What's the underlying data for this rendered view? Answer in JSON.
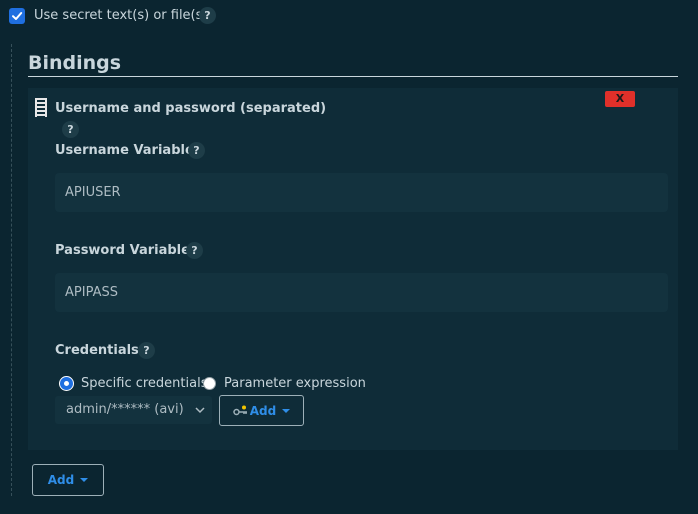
{
  "use_secret": {
    "checked": true,
    "label": "Use secret text(s) or file(s)",
    "help": "?"
  },
  "bindings": {
    "title": "Bindings",
    "binding": {
      "type_label": "Username and password (separated)",
      "type_help": "?",
      "delete_label": "X",
      "username": {
        "label": "Username Variable",
        "help": "?",
        "value": "APIUSER"
      },
      "password": {
        "label": "Password Variable",
        "help": "?",
        "value": "APIPASS"
      },
      "credentials": {
        "label": "Credentials",
        "help": "?",
        "options": {
          "specific": "Specific credentials",
          "parameter": "Parameter expression"
        },
        "selected_mode": "specific",
        "selected_value": "admin/****** (avi)",
        "add_label": "Add"
      }
    },
    "add_label": "Add"
  },
  "colors": {
    "background": "#0b2530",
    "panel": "#0f2c38",
    "accent": "#1f6fe0",
    "link": "#2f8ee8",
    "danger": "#e0302a"
  },
  "icons": {
    "checkbox": "check-icon",
    "drag": "drag-handle-icon",
    "key": "key-icon",
    "chevron": "chevron-down-icon",
    "caret": "caret-down-icon"
  }
}
